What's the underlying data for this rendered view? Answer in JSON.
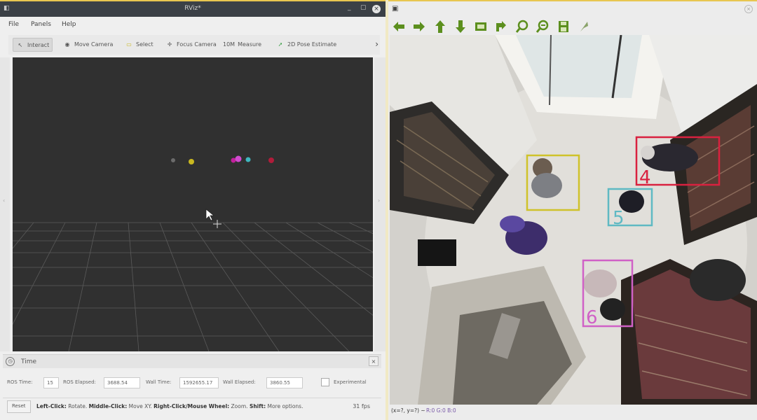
{
  "left_window": {
    "title": "RViz*",
    "app_icon": "rviz-icon",
    "window_buttons": [
      "_",
      "▢"
    ],
    "close_glyph": "×",
    "menu": [
      "File",
      "Panels",
      "Help"
    ],
    "toolbar": {
      "tools": [
        {
          "name": "interact",
          "label": "Interact",
          "icon": "pointer-icon",
          "glyph": "↖",
          "active": true
        },
        {
          "name": "move-camera",
          "label": "Move Camera",
          "icon": "eye-icon",
          "glyph": "◉",
          "active": false
        },
        {
          "name": "select",
          "label": "Select",
          "icon": "select-box-icon",
          "glyph": "▭",
          "active": false
        },
        {
          "name": "focus-camera",
          "label": "Focus Camera",
          "icon": "crosshair-icon",
          "glyph": "✛",
          "active": false
        },
        {
          "name": "measure",
          "label": "Measure",
          "icon": "ruler-icon",
          "glyph": "10M",
          "active": false
        },
        {
          "name": "2d-pose-estimate",
          "label": "2D Pose Estimate",
          "icon": "arrow-green-icon",
          "glyph": "➚",
          "active": false
        }
      ],
      "more_glyph": "›"
    },
    "time_panel": {
      "label": "Time",
      "clock_glyph": "◷",
      "close_glyph": "×",
      "fields": {
        "ros_time_label": "ROS Time:",
        "ros_time_value": "15",
        "ros_elapsed_label": "ROS Elapsed:",
        "ros_elapsed_value": "3688.54",
        "wall_time_label": "Wall Time:",
        "wall_time_value": "1592655.17",
        "wall_elapsed_label": "Wall Elapsed:",
        "wall_elapsed_value": "3860.55",
        "experimental_label": "Experimental"
      }
    },
    "status": {
      "reset_label": "Reset",
      "hint_left_click": "Left-Click:",
      "hint_left_click_desc": " Rotate. ",
      "hint_middle_click": "Middle-Click:",
      "hint_middle_click_desc": " Move XY. ",
      "hint_right_click": "Right-Click/Mouse Wheel:",
      "hint_right_click_desc": " Zoom. ",
      "hint_shift": "Shift:",
      "hint_shift_desc": " More options.",
      "fps": "31 fps"
    },
    "markers": [
      {
        "color": "#6b6b6b"
      },
      {
        "color": "#c9b820"
      },
      {
        "color": "#c3209c"
      },
      {
        "color": "#d04bd0"
      },
      {
        "color": "#3fb7bf"
      },
      {
        "color": "#b01c3a"
      }
    ]
  },
  "right_window": {
    "app_icon_glyph": "▣",
    "title": "",
    "close_glyph": "×",
    "toolbar_icons": [
      "arrow-left-icon",
      "arrow-right-icon",
      "arrow-up-icon",
      "arrow-down-icon",
      "save-image-icon",
      "pan-icon",
      "zoom-in-icon",
      "zoom-out-icon",
      "save-icon",
      "pointer-icon"
    ],
    "detections": [
      {
        "id": "",
        "color": "#cfc22a",
        "label_color": "#cfc22a"
      },
      {
        "id": "5",
        "color": "#5fb9c3",
        "label_color": "#5fb9c3"
      },
      {
        "id": "4",
        "color": "#d9213f",
        "label_color": "#d9213f"
      },
      {
        "id": "6",
        "color": "#d061c6",
        "label_color": "#d061c6"
      }
    ],
    "status_text": "(x=?, y=?) ~",
    "status_rgb": "R:0 G:0 B:0"
  }
}
